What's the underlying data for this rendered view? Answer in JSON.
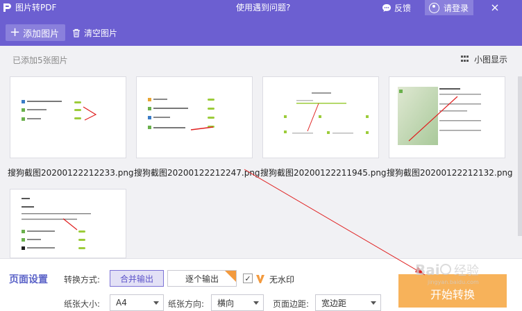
{
  "titlebar": {
    "app_title": "图片转PDF",
    "help_link": "使用遇到问题?",
    "feedback_label": "反馈",
    "login_label": "请登录"
  },
  "toolbar": {
    "add_label": "添加图片",
    "clear_label": "清空图片"
  },
  "content": {
    "count_label": "已添加5张图片",
    "view_toggle_label": "小图显示",
    "images": [
      {
        "name": "搜狗截图20200122212233.png"
      },
      {
        "name": "搜狗截图20200122212247.png"
      },
      {
        "name": "搜狗截图20200122211945.png"
      },
      {
        "name": "搜狗截图20200122212132.png"
      },
      {
        "name": ""
      }
    ]
  },
  "settings": {
    "title": "页面设置",
    "mode_label": "转换方式:",
    "merge_option": "合并输出",
    "single_option": "逐个输出",
    "watermark_label": "无水印",
    "paper_size_label": "纸张大小:",
    "paper_size_value": "A4",
    "orientation_label": "纸张方向:",
    "orientation_value": "横向",
    "margin_label": "页面边距:",
    "margin_value": "宽边距",
    "convert_button": "开始转换"
  },
  "colors": {
    "accent": "#6c5fd1",
    "convert": "#f7b25a",
    "annotation": "#e02020"
  },
  "watermark_text": "Bai 经验 jingyan.baidu.com"
}
